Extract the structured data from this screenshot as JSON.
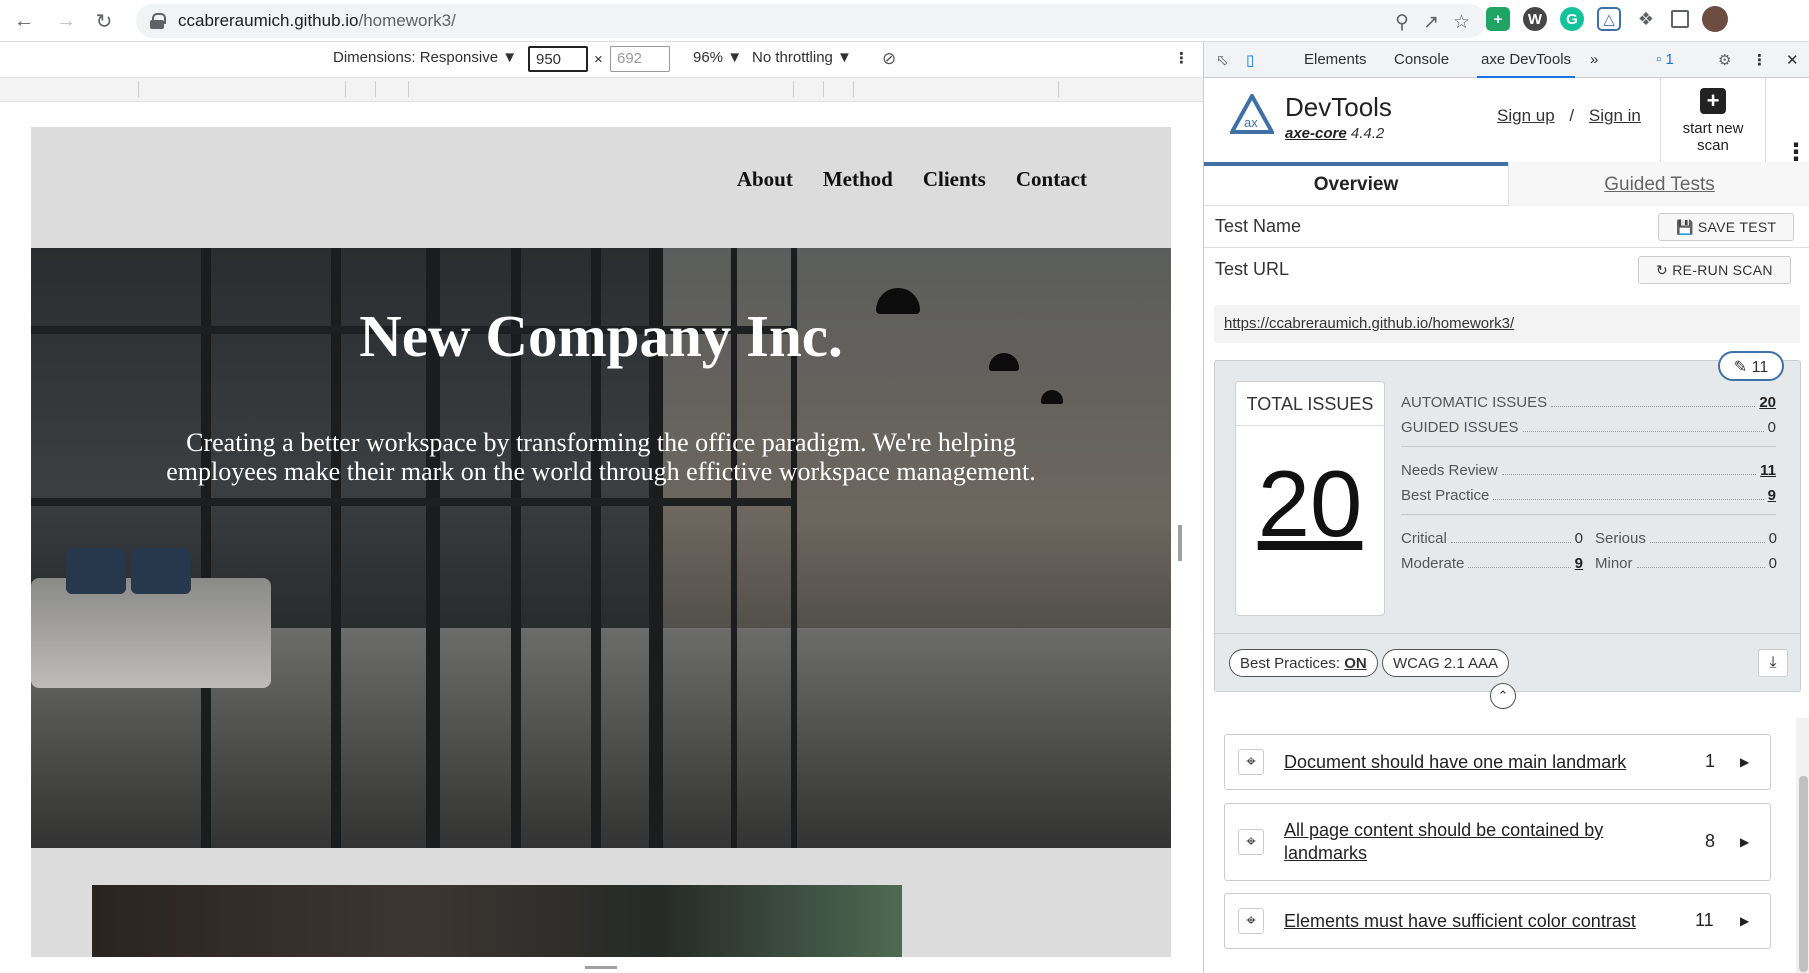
{
  "browser": {
    "url_host": "ccabreraumich.github.io",
    "url_path": "/homework3/"
  },
  "device_toolbar": {
    "dimensions_label": "Dimensions: Responsive ▼",
    "width": "950",
    "height_placeholder": "692",
    "times": "×",
    "zoom": "96% ▼",
    "throttling": "No throttling ▼"
  },
  "site": {
    "nav": [
      "About",
      "Method",
      "Clients",
      "Contact"
    ],
    "hero_title": "New Company Inc.",
    "hero_text": "Creating a better workspace by transforming the office paradigm. We're helping employees make their mark on the world through effictive workspace management."
  },
  "devtools": {
    "tabs": [
      "Elements",
      "Console",
      "axe DevTools"
    ],
    "issues_badge": "1",
    "axe": {
      "title": "DevTools",
      "core_link": "axe-core",
      "version": "4.4.2",
      "sign_up": "Sign up",
      "slash": "/",
      "sign_in": "Sign in",
      "new_scan_line1": "start new",
      "new_scan_line2": "scan",
      "tab_overview": "Overview",
      "tab_guided": "Guided Tests",
      "test_name_label": "Test Name",
      "save_test": "SAVE TEST",
      "test_url_label": "Test URL",
      "rerun_scan": "RE-RUN SCAN",
      "test_url": "https://ccabreraumich.github.io/homework3/",
      "needs_review_pill": "11",
      "total_issues_label": "TOTAL ISSUES",
      "total_issues": "20",
      "automatic_label": "AUTOMATIC ISSUES",
      "automatic": "20",
      "guided_label": "GUIDED ISSUES",
      "guided": "0",
      "needs_review_label": "Needs Review",
      "needs_review": "11",
      "best_practice_label": "Best Practice",
      "best_practice": "9",
      "critical_label": "Critical",
      "critical": "0",
      "serious_label": "Serious",
      "serious": "0",
      "moderate_label": "Moderate",
      "moderate": "9",
      "minor_label": "Minor",
      "minor": "0",
      "best_practices_label": "Best Practices:",
      "best_practices_value": "ON",
      "wcag_label": "WCAG 2.1 AAA",
      "issues": [
        {
          "title": "Document should have one main landmark",
          "count": "1"
        },
        {
          "title": "All page content should be contained by landmarks",
          "count": "8"
        },
        {
          "title": "Elements must have sufficient color contrast",
          "count": "11"
        }
      ]
    }
  },
  "colors": {
    "accent": "#1a73e8",
    "axe_blue": "#3f71a6",
    "page_bg": "#dcdcdc"
  }
}
